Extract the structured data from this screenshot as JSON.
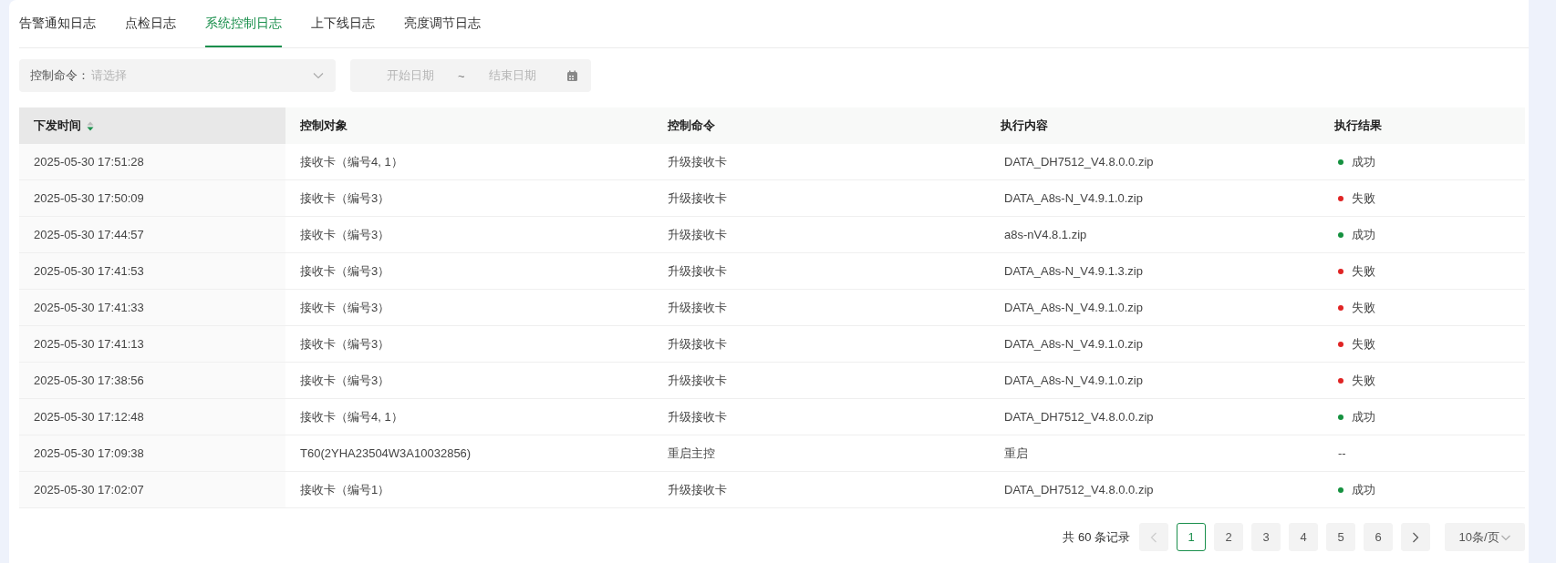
{
  "tabs": [
    {
      "label": "告警通知日志",
      "selected": false
    },
    {
      "label": "点检日志",
      "selected": false
    },
    {
      "label": "系统控制日志",
      "selected": true
    },
    {
      "label": "上下线日志",
      "selected": false
    },
    {
      "label": "亮度调节日志",
      "selected": false
    }
  ],
  "filters": {
    "command": {
      "label": "控制命令：",
      "placeholder": "请选择"
    },
    "date_range": {
      "start_placeholder": "开始日期",
      "separator": "~",
      "end_placeholder": "结束日期"
    }
  },
  "table": {
    "columns": [
      {
        "label": "下发时间",
        "sorted": true
      },
      {
        "label": "控制对象",
        "sorted": false
      },
      {
        "label": "控制命令",
        "sorted": false
      },
      {
        "label": "执行内容",
        "sorted": false
      },
      {
        "label": "执行结果",
        "sorted": false
      }
    ],
    "rows": [
      {
        "time": "2025-05-30 17:51:28",
        "target": "接收卡（编号4, 1）",
        "command": "升级接收卡",
        "content": "DATA_DH7512_V4.8.0.0.zip",
        "result": {
          "text": "成功",
          "color": "#15913f"
        }
      },
      {
        "time": "2025-05-30 17:50:09",
        "target": "接收卡（编号3）",
        "command": "升级接收卡",
        "content": "DATA_A8s-N_V4.9.1.0.zip",
        "result": {
          "text": "失败",
          "color": "#e02424"
        }
      },
      {
        "time": "2025-05-30 17:44:57",
        "target": "接收卡（编号3）",
        "command": "升级接收卡",
        "content": "a8s-nV4.8.1.zip",
        "result": {
          "text": "成功",
          "color": "#15913f"
        }
      },
      {
        "time": "2025-05-30 17:41:53",
        "target": "接收卡（编号3）",
        "command": "升级接收卡",
        "content": "DATA_A8s-N_V4.9.1.3.zip",
        "result": {
          "text": "失败",
          "color": "#e02424"
        }
      },
      {
        "time": "2025-05-30 17:41:33",
        "target": "接收卡（编号3）",
        "command": "升级接收卡",
        "content": "DATA_A8s-N_V4.9.1.0.zip",
        "result": {
          "text": "失败",
          "color": "#e02424"
        }
      },
      {
        "time": "2025-05-30 17:41:13",
        "target": "接收卡（编号3）",
        "command": "升级接收卡",
        "content": "DATA_A8s-N_V4.9.1.0.zip",
        "result": {
          "text": "失败",
          "color": "#e02424"
        }
      },
      {
        "time": "2025-05-30 17:38:56",
        "target": "接收卡（编号3）",
        "command": "升级接收卡",
        "content": "DATA_A8s-N_V4.9.1.0.zip",
        "result": {
          "text": "失败",
          "color": "#e02424"
        }
      },
      {
        "time": "2025-05-30 17:12:48",
        "target": "接收卡（编号4, 1）",
        "command": "升级接收卡",
        "content": "DATA_DH7512_V4.8.0.0.zip",
        "result": {
          "text": "成功",
          "color": "#15913f"
        }
      },
      {
        "time": "2025-05-30 17:09:38",
        "target": "T60(2YHA23504W3A10032856)",
        "command": "重启主控",
        "content": "重启",
        "result": {
          "text": "--"
        }
      },
      {
        "time": "2025-05-30 17:02:07",
        "target": "接收卡（编号1）",
        "command": "升级接收卡",
        "content": "DATA_DH7512_V4.8.0.0.zip",
        "result": {
          "text": "成功",
          "color": "#15913f"
        }
      }
    ]
  },
  "pagination": {
    "total": "共 60 条记录",
    "prev_disabled": true,
    "next_disabled": false,
    "pages": [
      {
        "label": "1",
        "selected": true
      },
      {
        "label": "2",
        "selected": false
      },
      {
        "label": "3",
        "selected": false
      },
      {
        "label": "4",
        "selected": false
      },
      {
        "label": "5",
        "selected": false
      },
      {
        "label": "6",
        "selected": false
      }
    ],
    "page_size": "10条/页"
  }
}
